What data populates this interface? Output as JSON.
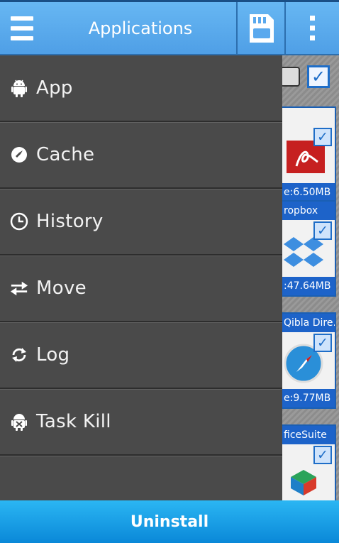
{
  "header": {
    "title": "Applications"
  },
  "drawer": {
    "items": [
      {
        "label": "App",
        "icon": "android-icon"
      },
      {
        "label": "Cache",
        "icon": "broom-icon"
      },
      {
        "label": "History",
        "icon": "clock-icon"
      },
      {
        "label": "Move",
        "icon": "swap-arrows-icon"
      },
      {
        "label": "Log",
        "icon": "refresh-icon"
      },
      {
        "label": "Task Kill",
        "icon": "android-kill-icon"
      }
    ]
  },
  "apps": [
    {
      "name": "",
      "size": "e:6.50MB",
      "checked": true
    },
    {
      "name": "ropbox",
      "size": ":47.64MB",
      "checked": true
    },
    {
      "name": "Qibla Dire...",
      "size": "e:9.77MB",
      "checked": true
    },
    {
      "name": "ficeSuite",
      "size": "",
      "checked": true
    }
  ],
  "footer": {
    "uninstall_label": "Uninstall"
  },
  "colors": {
    "header_blue": "#5aa9ee",
    "drawer_bg": "#4a4a4a",
    "footer_blue": "#1a9fe6"
  }
}
